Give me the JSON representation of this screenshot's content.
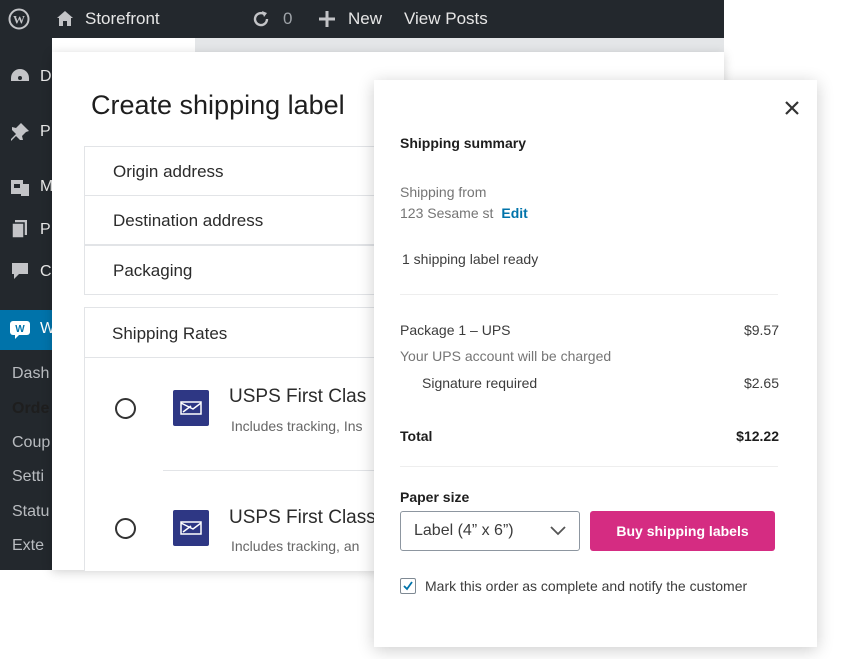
{
  "adminbar": {
    "site_name": "Storefront",
    "updates_count": "0",
    "new_label": "New",
    "view_posts_label": "View Posts"
  },
  "sidebar": {
    "top_letters": [
      "D",
      "P",
      "M",
      "P",
      "C"
    ],
    "woo_letter": "W",
    "sub_items": [
      "Dash",
      "Orde",
      "Coup",
      "Setti",
      "Statu",
      "Exte"
    ]
  },
  "modal": {
    "title": "Create shipping label",
    "steps": [
      "Origin address",
      "Destination address",
      "Packaging"
    ],
    "rates_title": "Shipping Rates",
    "rates": [
      {
        "name": "USPS First Clas",
        "desc": "Includes tracking, Ins"
      },
      {
        "name": "USPS First Class",
        "desc": "Includes tracking, an"
      }
    ]
  },
  "summary": {
    "title": "Shipping summary",
    "shipping_from_label": "Shipping from",
    "address": "123 Sesame st",
    "edit_label": "Edit",
    "ready_text": "1 shipping label ready",
    "package_label": "Package 1 – UPS",
    "package_price": "$9.57",
    "charged_note": "Your UPS account will be charged",
    "signature_label": "Signature required",
    "signature_price": "$2.65",
    "total_label": "Total",
    "total_price": "$12.22",
    "paper_size_label": "Paper size",
    "paper_size_value": "Label (4” x 6”)",
    "buy_button": "Buy shipping labels",
    "mark_complete_label": "Mark this order as complete and notify the customer",
    "mark_complete_checked": true
  },
  "colors": {
    "adminbar": "#23282d",
    "accent_blue": "#0073aa",
    "buy_button": "#d52c82",
    "usps_blue": "#2e3784"
  }
}
